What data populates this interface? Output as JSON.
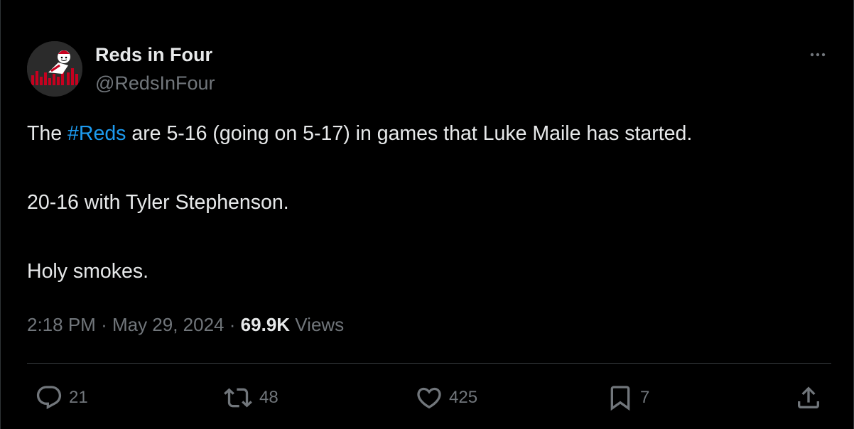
{
  "tweet": {
    "author": {
      "display_name": "Reds in Four",
      "handle": "@RedsInFour",
      "avatar_icon": "reds-mascot-logo"
    },
    "text": {
      "line1_prefix": "The ",
      "line1_hashtag": "#Reds",
      "line1_suffix": " are 5-16 (going on 5-17) in games that Luke Maile has started.",
      "line2": "20-16 with Tyler Stephenson.",
      "line3": "Holy smokes."
    },
    "meta": {
      "time": "2:18 PM",
      "separator": "·",
      "date": "May 29, 2024",
      "views_count": "69.9K",
      "views_label": "Views"
    },
    "actions": {
      "replies": "21",
      "reposts": "48",
      "likes": "425",
      "bookmarks": "7"
    }
  },
  "colors": {
    "background": "#000000",
    "text_primary": "#e7e9ea",
    "text_secondary": "#71767b",
    "hashtag": "#1d9bf0",
    "divider": "#2f3336"
  }
}
